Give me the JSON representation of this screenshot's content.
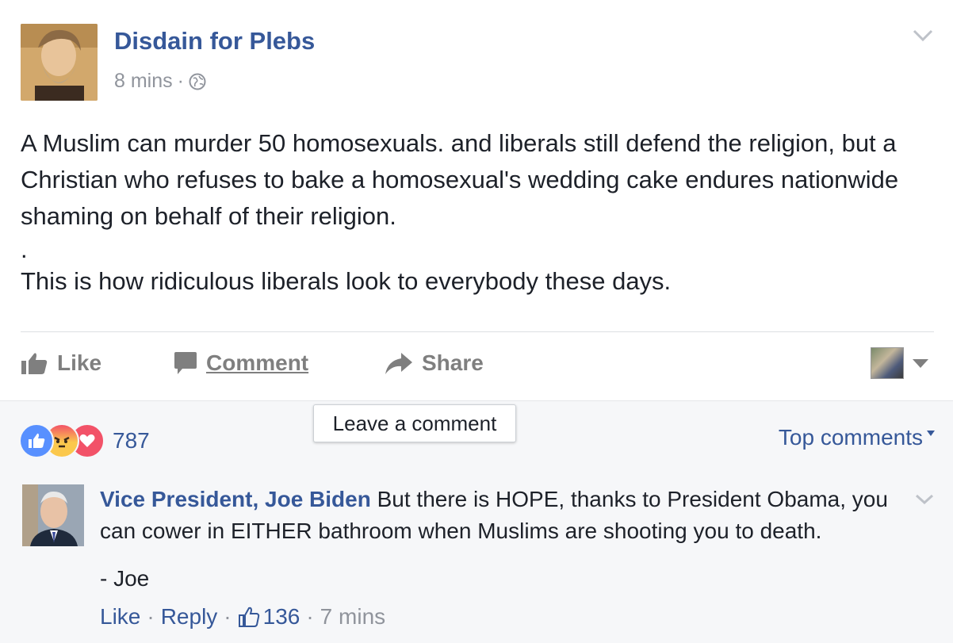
{
  "post": {
    "page_name": "Disdain for Plebs",
    "time": "8 mins",
    "separator": "·",
    "audience_icon": "globe-icon",
    "paragraphs": [
      "A Muslim can murder 50 homosexuals. and liberals still defend the religion, but a Christian who refuses to bake a homosexual's wedding cake endures nationwide shaming on behalf of their religion.",
      ".",
      "This is how ridiculous liberals look to everybody these days."
    ]
  },
  "actions": {
    "like_label": "Like",
    "comment_label": "Comment",
    "share_label": "Share"
  },
  "tooltip": "Leave a comment",
  "reactions": {
    "count": "787",
    "types": [
      "like",
      "angry",
      "love"
    ]
  },
  "top_comments_label": "Top comments",
  "comment": {
    "author": "Vice President, Joe Biden",
    "text": "But there is HOPE, thanks to President Obama, you can cower in EITHER bathroom when Muslims are shooting you to death.",
    "signature": "- Joe",
    "like_label": "Like",
    "reply_label": "Reply",
    "likes": "136",
    "time": "7 mins",
    "separator": "·"
  },
  "colors": {
    "link": "#365899",
    "meta": "#90949c",
    "text": "#1d2129",
    "action_gray": "#7f7f7f",
    "like_blue": "#5890ff",
    "love_red": "#f25268"
  }
}
